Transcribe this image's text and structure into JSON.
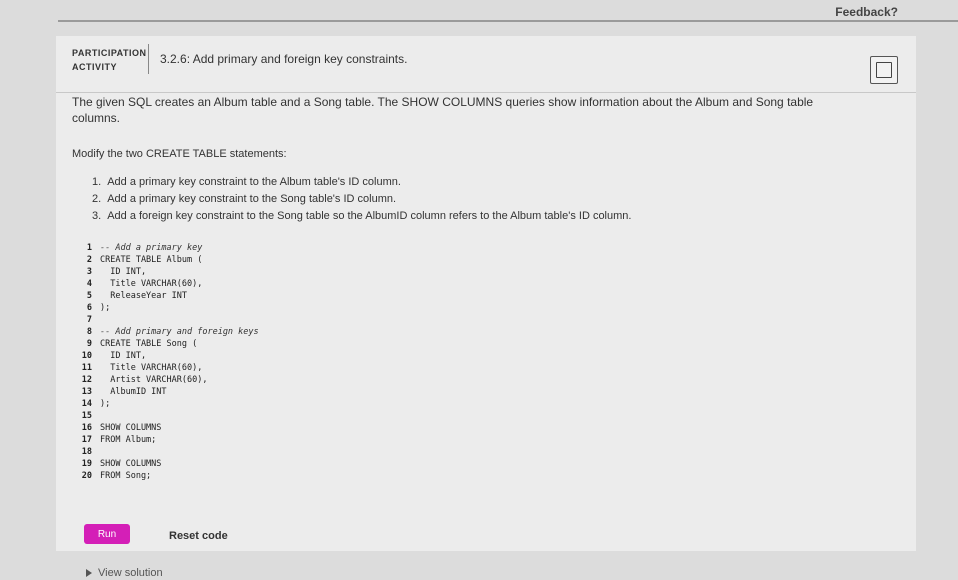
{
  "header": {
    "feedback_label": "Feedback?"
  },
  "activity": {
    "participation_line1": "PARTICIPATION",
    "participation_line2": "ACTIVITY",
    "title": "3.2.6: Add primary and foreign key constraints."
  },
  "instructions": {
    "intro": "The given SQL creates an Album table and a Song table. The SHOW COLUMNS queries show information about the Album and Song table columns.",
    "modify": "Modify the two CREATE TABLE statements:",
    "steps": [
      {
        "num": "1.",
        "text": "Add a primary key constraint to the Album table's ID column."
      },
      {
        "num": "2.",
        "text": "Add a primary key constraint to the Song table's ID column."
      },
      {
        "num": "3.",
        "text": "Add a foreign key constraint to the Song table so the AlbumID column refers to the Album table's ID column."
      }
    ]
  },
  "code": {
    "lines": [
      {
        "n": "1",
        "text": "-- Add a primary key",
        "comment": true
      },
      {
        "n": "2",
        "text": "CREATE TABLE Album ("
      },
      {
        "n": "3",
        "text": "  ID INT,"
      },
      {
        "n": "4",
        "text": "  Title VARCHAR(60),"
      },
      {
        "n": "5",
        "text": "  ReleaseYear INT"
      },
      {
        "n": "6",
        "text": ");"
      },
      {
        "n": "7",
        "text": ""
      },
      {
        "n": "8",
        "text": "-- Add primary and foreign keys",
        "comment": true
      },
      {
        "n": "9",
        "text": "CREATE TABLE Song ("
      },
      {
        "n": "10",
        "text": "  ID INT,"
      },
      {
        "n": "11",
        "text": "  Title VARCHAR(60),"
      },
      {
        "n": "12",
        "text": "  Artist VARCHAR(60),"
      },
      {
        "n": "13",
        "text": "  AlbumID INT"
      },
      {
        "n": "14",
        "text": ");"
      },
      {
        "n": "15",
        "text": ""
      },
      {
        "n": "16",
        "text": "SHOW COLUMNS"
      },
      {
        "n": "17",
        "text": "FROM Album;"
      },
      {
        "n": "18",
        "text": ""
      },
      {
        "n": "19",
        "text": "SHOW COLUMNS"
      },
      {
        "n": "20",
        "text": "FROM Song;"
      }
    ]
  },
  "actions": {
    "run_label": "Run",
    "reset_label": "Reset code",
    "view_solution_label": "View solution"
  },
  "colors": {
    "run_button": "#d41fb7"
  }
}
